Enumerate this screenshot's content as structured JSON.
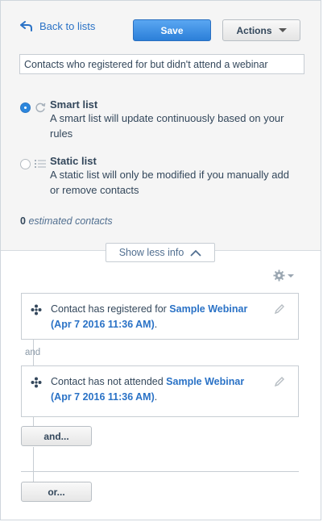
{
  "header": {
    "back_label": "Back to lists",
    "save_label": "Save",
    "actions_label": "Actions"
  },
  "list_name": {
    "value": "Contacts who registered for but didn't attend a webinar"
  },
  "list_types": [
    {
      "title": "Smart list",
      "description": "A smart list will update continuously based on your rules",
      "selected": true,
      "icon": "refresh-icon"
    },
    {
      "title": "Static list",
      "description": "A static list will only be modified if you manually add or remove contacts",
      "selected": false,
      "icon": "list-icon"
    }
  ],
  "estimate": {
    "count": "0",
    "label": "estimated contacts"
  },
  "toggle_info_label": "Show less info",
  "rules": [
    {
      "prefix": "Contact has registered for ",
      "link": "Sample Webinar",
      "date": "(Apr 7 2016 11:36 AM)",
      "suffix": "."
    },
    {
      "prefix": "Contact has not attended ",
      "link": "Sample Webinar",
      "date": "(Apr 7 2016 11:36 AM)",
      "suffix": "."
    }
  ],
  "connector_label": "and",
  "and_button_label": "and...",
  "or_button_label": "or...",
  "colors": {
    "accent": "#2b86dd",
    "link": "#2a72c6",
    "text": "#33475b"
  }
}
